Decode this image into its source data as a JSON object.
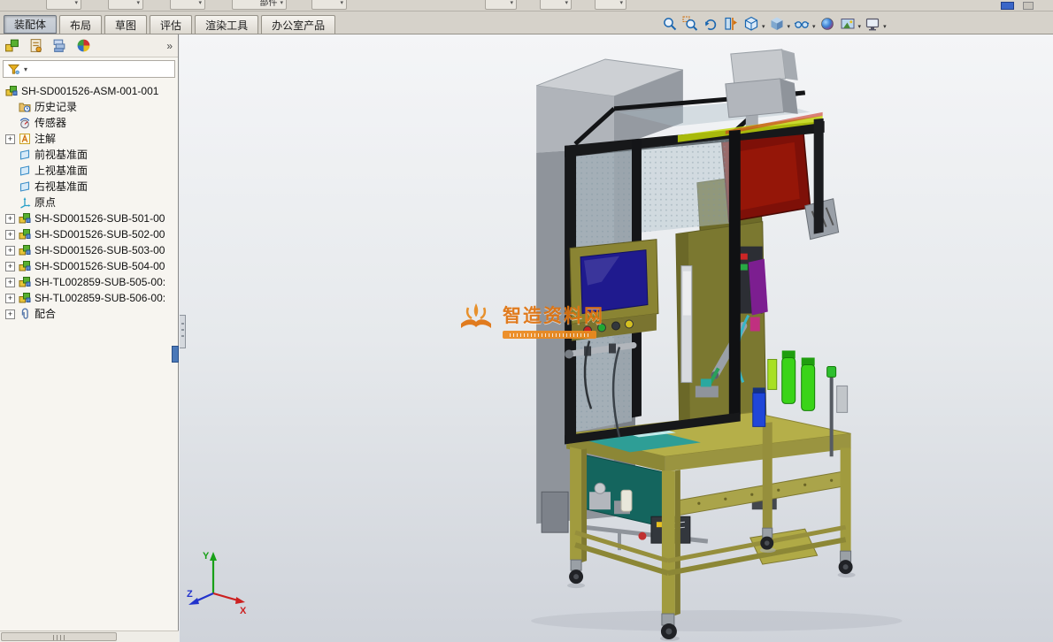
{
  "glyphs": {
    "plus": "+",
    "caret": "▾",
    "chevrons": "»"
  },
  "top_strip": {
    "partial_label": "部件"
  },
  "ribbon": {
    "tabs": [
      {
        "label": "装配体",
        "active": true
      },
      {
        "label": "布局",
        "active": false
      },
      {
        "label": "草图",
        "active": false
      },
      {
        "label": "评估",
        "active": false
      },
      {
        "label": "渲染工具",
        "active": false
      },
      {
        "label": "办公室产品",
        "active": false
      }
    ]
  },
  "heads_up": {
    "buttons": [
      {
        "name": "zoom-to-fit",
        "icon": "magnifier-icon",
        "has_dropdown": false
      },
      {
        "name": "zoom-to-area",
        "icon": "magnifier-area-icon",
        "has_dropdown": false
      },
      {
        "name": "previous-view",
        "icon": "rotate-arrow-icon",
        "has_dropdown": false
      },
      {
        "name": "section-view",
        "icon": "section-plane-icon",
        "has_dropdown": false
      },
      {
        "name": "view-orientation",
        "icon": "view-cube-icon",
        "has_dropdown": true
      },
      {
        "name": "display-style",
        "icon": "shaded-cube-icon",
        "has_dropdown": true
      },
      {
        "name": "hide-show-items",
        "icon": "glasses-icon",
        "has_dropdown": true
      },
      {
        "name": "edit-appearance",
        "icon": "appearance-sphere-icon",
        "has_dropdown": false
      },
      {
        "name": "apply-scene",
        "icon": "scene-icon",
        "has_dropdown": true
      },
      {
        "name": "view-settings",
        "icon": "monitor-icon",
        "has_dropdown": true
      }
    ]
  },
  "panel": {
    "tabs": [
      "feature-manager-tab",
      "property-manager-tab",
      "configuration-manager-tab",
      "display-manager-tab"
    ],
    "tree": {
      "root": {
        "label": "SH-SD001526-ASM-001-001",
        "icon": "assembly-icon"
      },
      "items": [
        {
          "label": "历史记录",
          "icon": "history-folder-icon",
          "expand": false
        },
        {
          "label": "传感器",
          "icon": "sensors-icon",
          "expand": false
        },
        {
          "label": "注解",
          "icon": "annotations-icon",
          "expand": true
        },
        {
          "label": "前视基准面",
          "icon": "plane-icon",
          "expand": false
        },
        {
          "label": "上视基准面",
          "icon": "plane-icon",
          "expand": false
        },
        {
          "label": "右视基准面",
          "icon": "plane-icon",
          "expand": false
        },
        {
          "label": "原点",
          "icon": "origin-icon",
          "expand": false
        },
        {
          "label": "SH-SD001526-SUB-501-00",
          "icon": "subassembly-icon",
          "expand": true
        },
        {
          "label": "SH-SD001526-SUB-502-00",
          "icon": "subassembly-icon",
          "expand": true
        },
        {
          "label": "SH-SD001526-SUB-503-00",
          "icon": "subassembly-icon",
          "expand": true
        },
        {
          "label": "SH-SD001526-SUB-504-00",
          "icon": "subassembly-icon",
          "expand": true
        },
        {
          "label": "SH-TL002859-SUB-505-00:",
          "icon": "subassembly-icon",
          "expand": true
        },
        {
          "label": "SH-TL002859-SUB-506-00:",
          "icon": "subassembly-icon",
          "expand": true
        },
        {
          "label": "配合",
          "icon": "mates-icon",
          "expand": true
        }
      ]
    }
  },
  "watermark": {
    "text": "智造资料网",
    "color": "#e0730f"
  },
  "triad": {
    "x_label": "X",
    "y_label": "Y",
    "z_label": "Z",
    "x_color": "#cc2020",
    "y_color": "#18a018",
    "z_color": "#2233cc"
  },
  "colors": {
    "tab_bar_bg": "#d6d2ca",
    "panel_bg": "#f7f5f0",
    "viewport_top": "#f4f5f7",
    "viewport_bottom": "#cfd3da",
    "selection_blue": "#4a78b8",
    "watermark_orange": "#e0730f"
  },
  "machine_colors": {
    "frame_black": "#17181a",
    "body_olive": "#7b7830",
    "table_yellow": "#b5af49",
    "red_panel": "#7e1008",
    "hmi_screen_blue": "#1f1a8e",
    "cabinet_gray": "#8f949b",
    "bright_green": "#3ad418",
    "bright_blue": "#1f46d8",
    "teal": "#2e9e96"
  }
}
